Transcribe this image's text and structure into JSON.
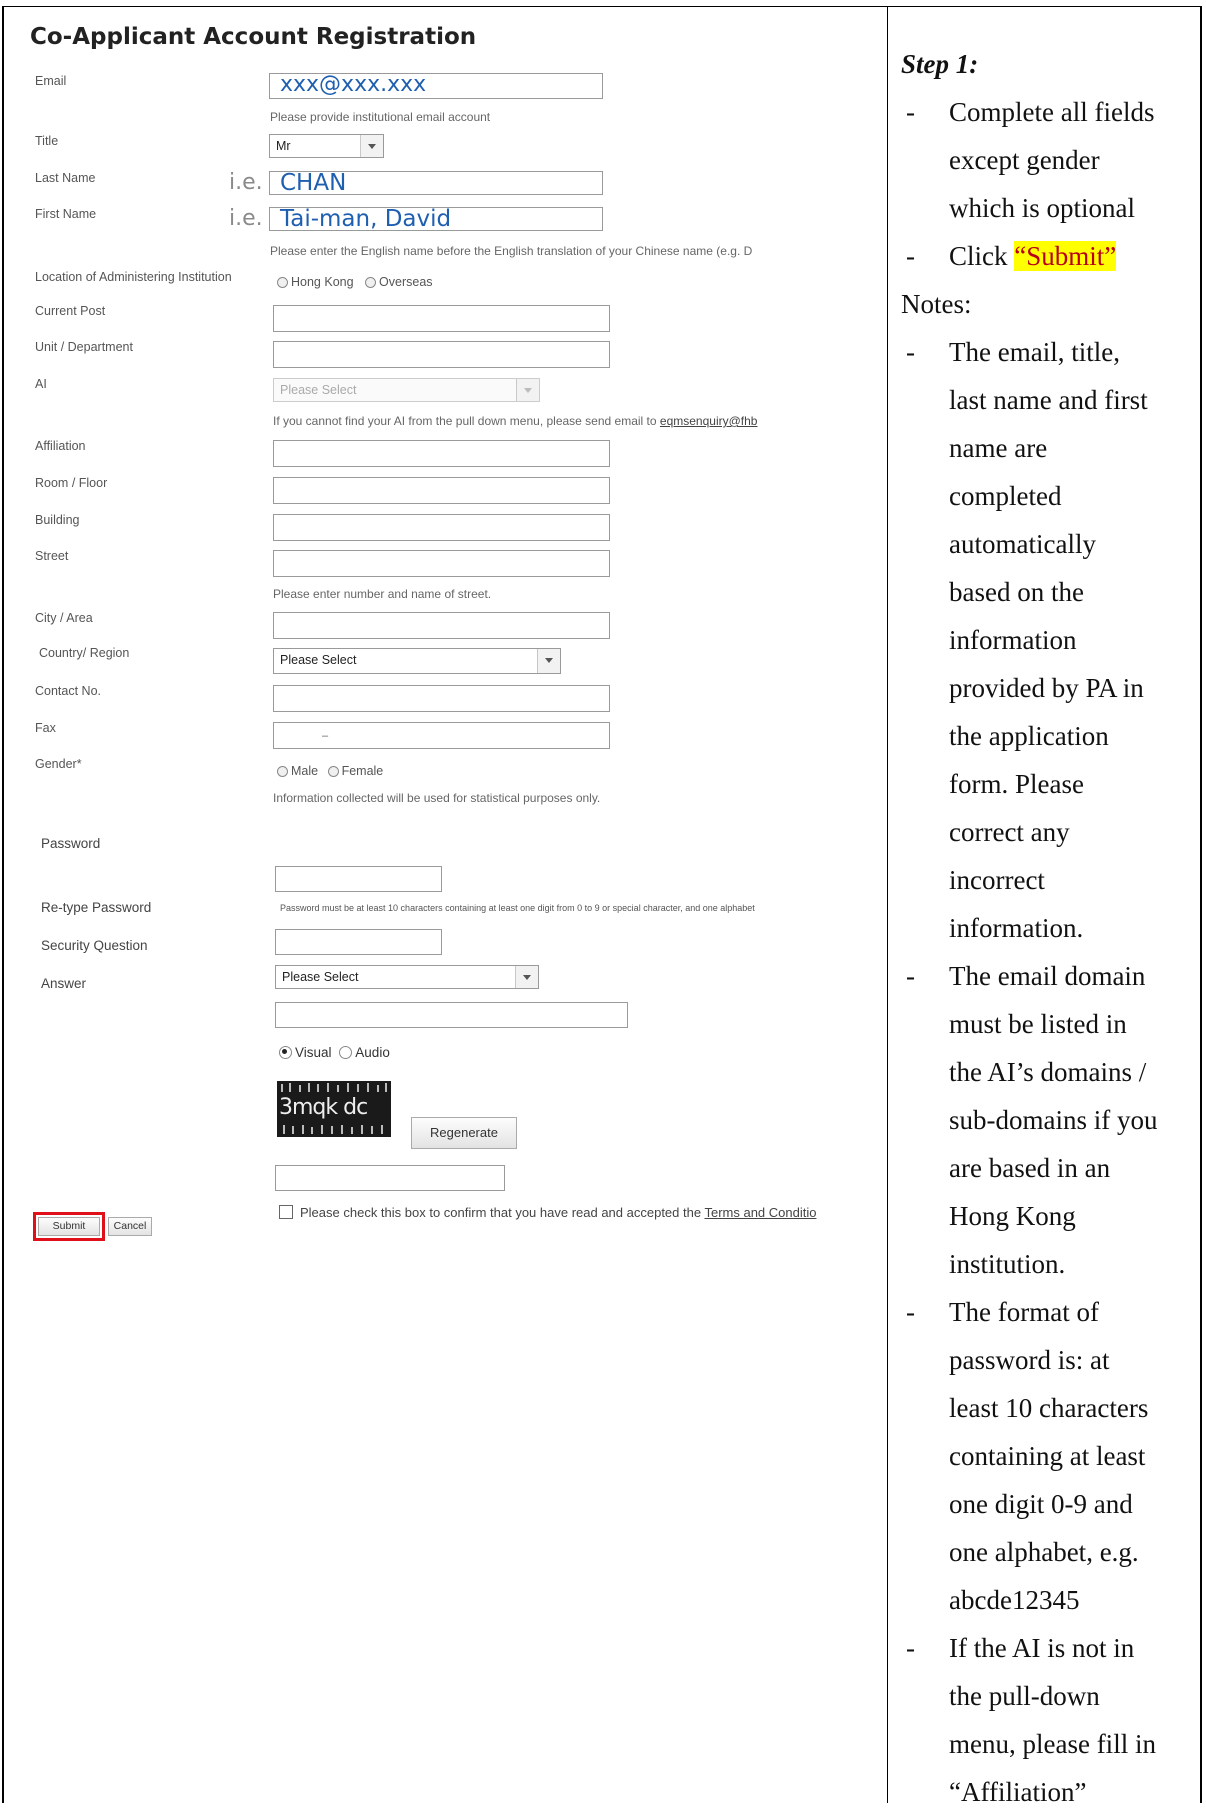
{
  "form": {
    "title": "Co-Applicant Account Registration",
    "labels": {
      "email": "Email",
      "title": "Title",
      "last_name": "Last Name",
      "first_name": "First Name",
      "location": "Location of Administering Institution",
      "current_post": "Current Post",
      "unit": "Unit / Department",
      "ai": "AI",
      "affiliation": "Affiliation",
      "room": "Room / Floor",
      "building": "Building",
      "street": "Street",
      "city": "City / Area",
      "country": "Country/ Region",
      "contact": "Contact No.",
      "fax": "Fax",
      "gender": "Gender*",
      "password": "Password",
      "retype_password": "Re-type Password",
      "security_question": "Security Question",
      "answer": "Answer"
    },
    "values": {
      "email": "xxx@xxx.xxx",
      "title": "Mr",
      "last_name_prefix": "i.e.",
      "last_name": "CHAN",
      "first_name_prefix": "i.e.",
      "first_name": "Tai-man, David",
      "ai": "Please Select",
      "country": "Please Select",
      "security_question": "Please Select",
      "fax": "–"
    },
    "hints": {
      "email": "Please provide institutional email account",
      "first_name": "Please enter the English name before the English translation of your Chinese name (e.g. D",
      "ai_prefix": "If you cannot find your AI from the pull down menu, please send email to",
      "ai_email": "eqmsenquiry@fhb",
      "street": "Please enter number and name of street.",
      "gender": "Information collected will be used for statistical purposes only.",
      "password": "Password must be at least 10 characters containing at least one digit from 0 to 9 or special character, and one alphabet"
    },
    "location_options": [
      "Hong Kong",
      "Overseas"
    ],
    "gender_options": [
      "Male",
      "Female"
    ],
    "captcha_options": [
      "Visual",
      "Audio"
    ],
    "captcha_text": "3mqk dc",
    "regenerate": "Regenerate",
    "terms_prefix": "Please check this box to confirm that you have read and accepted the",
    "terms_link": "Terms and Conditio",
    "submit": "Submit",
    "cancel": "Cancel"
  },
  "instructions": {
    "step": "Step 1:",
    "bullets1": [
      [
        "Complete all fields",
        "except gender",
        "which is optional"
      ]
    ],
    "click_prefix": "Click ",
    "click_label": "“Submit”",
    "notes": "Notes:",
    "bullets2": [
      [
        "The email, title,",
        "last name and first",
        "name are",
        "completed",
        "automatically",
        "based on the",
        "information",
        "provided by PA in",
        "the application",
        "form. Please",
        "correct any",
        "incorrect",
        "information."
      ],
      [
        "The email domain",
        "must be listed in",
        "the AI’s domains /",
        "sub-domains if you",
        "are based in an",
        "Hong Kong",
        "institution."
      ],
      [
        "The format of",
        "password is: at",
        "least 10 characters",
        "containing at least",
        "one digit 0-9 and",
        "one alphabet, e.g.",
        "abcde12345"
      ],
      [
        "If the AI is not in",
        "the pull-down",
        "menu, please fill in",
        "“Affiliation”"
      ]
    ]
  },
  "colors": {
    "accent_red": "#e0101a",
    "highlight": "#ffff00",
    "filled_text": "#1f5fb0"
  }
}
